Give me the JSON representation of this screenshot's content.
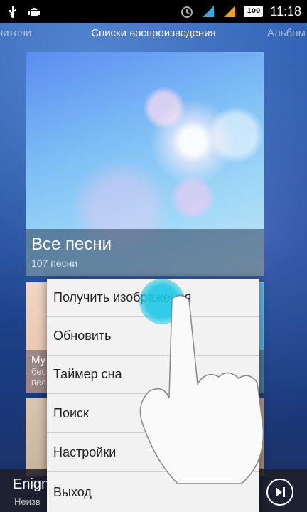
{
  "status_bar": {
    "left_icons": [
      "usb-icon",
      "android-debug-icon"
    ],
    "right_icons": [
      "alarm-icon",
      "signal-icon",
      "signal-icon",
      "battery-icon"
    ],
    "battery": "100",
    "time": "11:18"
  },
  "tabs": {
    "left": "нители",
    "center": "Списки воспроизведения",
    "right": "Альбом"
  },
  "playlist_main": {
    "title": "Все песни",
    "subtitle": "107 песни"
  },
  "playlist_second": {
    "title": "Му",
    "line2": "бес",
    "line3": "пес"
  },
  "now_playing": {
    "title": "Enign",
    "artist": "Неизв",
    "next_icon": "skip-next-icon"
  },
  "menu": {
    "items": [
      "Получить изображения",
      "Обновить",
      "Таймер сна",
      "Поиск",
      "Настройки",
      "Выход"
    ]
  }
}
